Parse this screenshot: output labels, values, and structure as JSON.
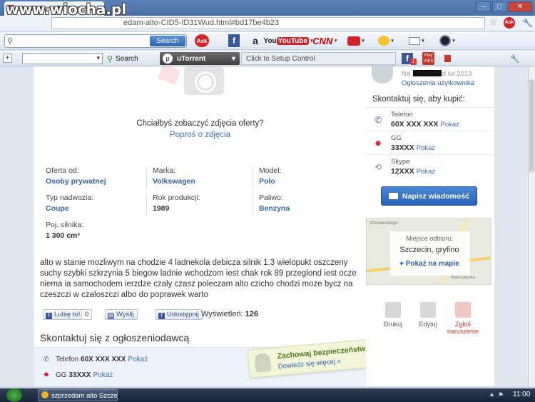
{
  "browser": {
    "tab_title": "szprzedam alto Szczecin • To",
    "watermark": "www.wiocha.pl",
    "url": "edam-alto-CID5-ID31Wud.html#bd17be4b23"
  },
  "ask_toolbar": {
    "search_value": "",
    "search_button": "Search",
    "ask_label": "Ask",
    "youtube_label": "YouTube",
    "cnn_label": "CNN"
  },
  "toolbar2": {
    "search_label": "Search",
    "utorrent_label": "uTorrent",
    "setup_label": "Click to Setup Control",
    "fb_badge": "1",
    "play_label": "Play VIBS"
  },
  "listing": {
    "photo_question": "Chciałbyś zobaczyć zdjęcia oferty?",
    "photo_request": "Poproś o zdjęcia",
    "params": [
      {
        "label": "Oferta od:",
        "value": "Osoby prywatnej"
      },
      {
        "label": "Marka:",
        "value": "Volkswagen"
      },
      {
        "label": "Model:",
        "value": "Polo"
      },
      {
        "label": "Typ nadwozia:",
        "value": "Coupe"
      },
      {
        "label": "Rok produkcji:",
        "value": "1989"
      },
      {
        "label": "Paliwo:",
        "value": "Benzyna"
      },
      {
        "label": "Poj. silnika:",
        "value": "1 300 cm³"
      }
    ],
    "description": "alto w stanie mozliwym na chodzie 4 ladnekola debicza silnik 1.3 wielopukt oszczeny suchy szybki szkrzynia 5 biegow ladnie wchodzom iest chak rok 89 przeglond iest ocze niema ia samochodem ierzdze czaly czasz poleczam alto czicho chodzi moze bycz na czeszczi w czaloszczi albo do poprawek warto",
    "like_label": "Lubię to!",
    "like_count": "0",
    "send_label": "Wyślij",
    "share_label": "Udostępnij",
    "views_label": "Wyświetleń:",
    "views_count": "126",
    "contact_heading": "Skontaktuj się z ogłoszeniodawcą",
    "contact_phone_label": "Telefon",
    "contact_phone_value": "60X XXX XXX",
    "contact_gg_label": "GG",
    "contact_gg_value": "33XXX",
    "show_label": "Pokaż",
    "safety_title": "Zachowaj bezpieczeństwo!",
    "safety_link": "Dowiedz się więcej »"
  },
  "sidebar": {
    "since_prefix": "Na",
    "since_suffix": "d lut 2013",
    "user_ads": "Ogłoszenia użytkownika",
    "contact_title": "Skontaktuj się, aby kupić:",
    "contacts": [
      {
        "label": "Telefon",
        "value": "60X XXX XXX",
        "show": "Pokaż"
      },
      {
        "label": "GG",
        "value": "33XXX",
        "show": "Pokaż"
      },
      {
        "label": "Skype",
        "value": "12XXX",
        "show": "Pokaż"
      }
    ],
    "message_button": "Napisz wiadomość",
    "map_label": "Miejsce odbioru:",
    "map_location": "Szczecin, gryfino",
    "map_link": "Pokaż na mapie",
    "map_street_1": "Wiśniewskiego",
    "map_street_2": "Warszawska",
    "actions": [
      "Drukuj",
      "Edytuj",
      "Zgłoś naruszenie"
    ]
  },
  "taskbar": {
    "task_label": "szprzedam alto Szczec...",
    "clock": "11:00"
  },
  "colors": {
    "link": "#2e62b0",
    "button": "#2a63b7",
    "report": "#c83a2a"
  }
}
